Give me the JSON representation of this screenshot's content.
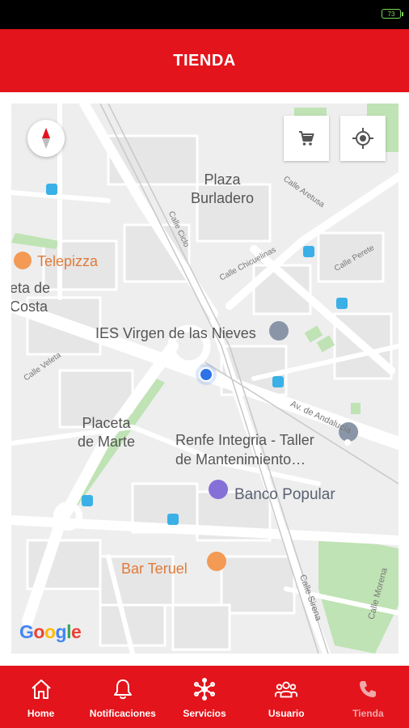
{
  "status_bar": {
    "battery_level": "73",
    "battery_color": "#7ed957"
  },
  "app_bar": {
    "title": "TIENDA",
    "color": "#e3141b"
  },
  "map": {
    "places": {
      "plaza_burladero": "Plaza\nBurladero",
      "placeta_de_marte": "Placeta\nde Marte",
      "veta_de_costa": "eta de\nCosta"
    },
    "pois": {
      "telepizza": "Telepizza",
      "ies": "IES Virgen de las Nieves",
      "renfe": "Renfe Integria - Taller\nde Mantenimiento…",
      "banco": "Banco Popular",
      "bar": "Bar Teruel"
    },
    "streets": {
      "calle_aretusa": "Calle Aretusa",
      "calle_ciclo": "Calle Ciclo",
      "calle_chicuelinas": "Calle Chicuelinas",
      "calle_perete": "Calle Perete",
      "calle_veleta": "Calle Veleta",
      "av_andalucia": "Av. de Andalucía",
      "calle_sirena": "Calle Sirena",
      "calle_morena": "Calle Morena"
    },
    "attribution": [
      "G",
      "o",
      "o",
      "g",
      "l",
      "e"
    ]
  },
  "bottom_nav": {
    "items": [
      {
        "label": "Home",
        "icon": "home-icon"
      },
      {
        "label": "Notificaciones",
        "icon": "bell-icon"
      },
      {
        "label": "Servicios",
        "icon": "services-icon"
      },
      {
        "label": "Usuario",
        "icon": "users-icon"
      },
      {
        "label": "Tienda",
        "icon": "phone-icon"
      }
    ],
    "active_index": 4
  }
}
